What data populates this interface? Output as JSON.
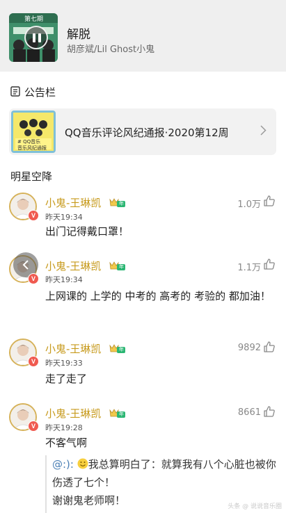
{
  "player": {
    "song_title": "解脱",
    "artist": "胡彦斌/Lil Ghost小鬼",
    "cover_text": "第七期",
    "state": "playing"
  },
  "notice": {
    "section_title": "公告栏",
    "card_title": "QQ音乐评论风纪通报·2020第12周",
    "thumb_lines": [
      "# QQ音乐",
      "音乐风纪通报"
    ]
  },
  "comments_section": {
    "title": "明星空降",
    "vip_label": "年",
    "verified_badge": "V",
    "items": [
      {
        "username": "小鬼-王琳凯",
        "time": "昨天19:34",
        "likes": "1.0万",
        "text": "出门记得戴口罩！"
      },
      {
        "username": "小鬼-王琳凯",
        "time": "昨天19:34",
        "likes": "1.1万",
        "text": "上网课的 上学的 中考的 高考的 考验的 都加油！"
      },
      {
        "username": "小鬼-王琳凯",
        "time": "昨天19:33",
        "likes": "9892",
        "text": "走了走了"
      },
      {
        "username": "小鬼-王琳凯",
        "time": "昨天19:28",
        "likes": "8661",
        "text": "不客气啊"
      }
    ],
    "reply": {
      "author": "@:):",
      "text": "我总算明白了：就算我有八个心脏也被你伤透了七个！",
      "text2": "谢谢鬼老师啊！"
    }
  },
  "watermark": "头条 @ 说说音乐圈",
  "colors": {
    "accent_gold": "#c79a1c",
    "vip_green": "#2bb673",
    "badge_red": "#f05a50"
  },
  "icons": [
    "pause-icon",
    "notice-icon",
    "chevron-right-icon",
    "like-icon",
    "back-arrow-icon"
  ]
}
